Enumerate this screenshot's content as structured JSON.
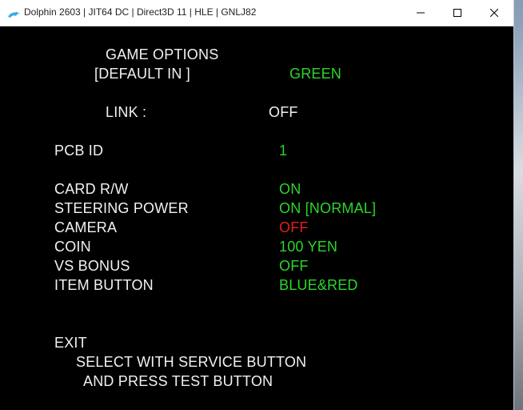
{
  "window": {
    "title": "Dolphin 2603 | JIT64 DC | Direct3D 11 | HLE | GNLJ82",
    "icon": "dolphin-icon",
    "controls": {
      "minimize": "minimize-icon",
      "maximize": "maximize-icon",
      "close": "close-icon"
    }
  },
  "menu": {
    "heading_line1": "GAME OPTIONS",
    "heading_line2": "[DEFAULT IN        ]",
    "default_value": "GREEN",
    "link_label": "LINK :",
    "link_value": "OFF",
    "pcb_label": "PCB ID",
    "pcb_value": "1",
    "options": [
      {
        "label": "CARD R/W",
        "value": "ON",
        "color": "#2bd62b"
      },
      {
        "label": "STEERING POWER",
        "value": "ON [NORMAL]",
        "color": "#2bd62b"
      },
      {
        "label": "CAMERA",
        "value": "OFF",
        "color": "#e02020"
      },
      {
        "label": "COIN",
        "value": "100 YEN",
        "color": "#2bd62b"
      },
      {
        "label": "VS BONUS",
        "value": "OFF",
        "color": "#2bd62b"
      },
      {
        "label": "ITEM BUTTON",
        "value": "BLUE&RED",
        "color": "#2bd62b"
      }
    ],
    "exit_label": "EXIT",
    "instruction_line1": "SELECT WITH SERVICE BUTTON",
    "instruction_line2": "AND PRESS TEST BUTTON"
  }
}
